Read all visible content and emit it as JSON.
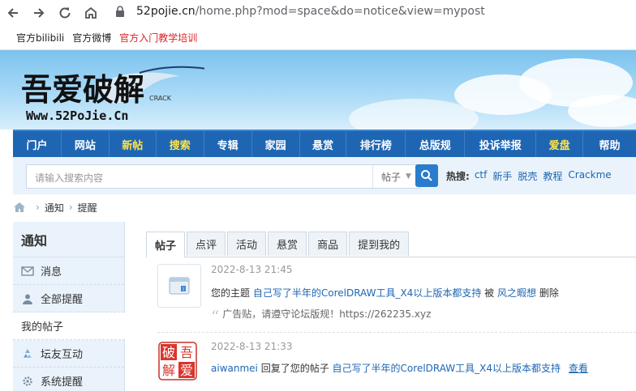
{
  "browser": {
    "url_domain": "52pojie.cn",
    "url_path": "/home.php?mod=space&do=notice&view=mypost"
  },
  "bookmarks": [
    "官方bilibili",
    "官方微博",
    "官方入门教学培训"
  ],
  "logo": {
    "wordmark": "吾爱破解",
    "site_url": "Www.52PoJie.Cn",
    "crack": "CRACK"
  },
  "nav": {
    "items": [
      {
        "label": "门户",
        "highlight": false
      },
      {
        "label": "网站",
        "highlight": false
      },
      {
        "label": "新帖",
        "highlight": true
      },
      {
        "label": "搜索",
        "highlight": true
      },
      {
        "label": "专辑",
        "highlight": false
      },
      {
        "label": "家园",
        "highlight": false
      },
      {
        "label": "悬赏",
        "highlight": false
      },
      {
        "label": "排行榜",
        "highlight": false
      },
      {
        "label": "总版规",
        "highlight": false
      },
      {
        "label": "投诉举报",
        "highlight": false
      },
      {
        "label": "爱盘",
        "highlight": true
      },
      {
        "label": "帮助",
        "highlight": false
      }
    ]
  },
  "search": {
    "placeholder": "请输入搜索内容",
    "category": "帖子",
    "hot_label": "热搜:",
    "hot_tags": [
      "ctf",
      "新手",
      "脱壳",
      "教程",
      "Crackme"
    ]
  },
  "breadcrumb": [
    "通知",
    "提醒"
  ],
  "sidebar": {
    "title": "通知",
    "items": [
      {
        "label": "消息",
        "icon": "envelope-icon",
        "active": false
      },
      {
        "label": "全部提醒",
        "icon": "person-icon",
        "active": false
      },
      {
        "label": "我的帖子",
        "icon": "none",
        "active": true
      },
      {
        "label": "坛友互动",
        "icon": "recycle-icon",
        "active": false
      },
      {
        "label": "系统提醒",
        "icon": "gear-icon",
        "active": false
      }
    ]
  },
  "tabs": [
    "帖子",
    "点评",
    "活动",
    "悬赏",
    "商品",
    "提到我的"
  ],
  "notices": [
    {
      "time": "2022-8-13 21:45",
      "prefix": "您的主题",
      "thread": "自己写了半年的CorelDRAW工具_X4以上版本都支持",
      "by": "被",
      "user": "风之暇想",
      "action": "删除",
      "quote": "广告贴，请遵守论坛版规！https://262235.xyz"
    },
    {
      "time": "2022-8-13 21:33",
      "user": "aiwanmei",
      "middle": "回复了您的帖子",
      "thread": "自己写了半年的CorelDRAW工具_X4以上版本都支持",
      "view": "查看",
      "avatar_text": [
        "破",
        "吾",
        "解",
        "爱"
      ]
    }
  ],
  "colors": {
    "nav_bg": "#1e66b3",
    "nav_highlight": "#ffe24a",
    "link": "#1e66b3",
    "bookmark_red": "#e02020"
  }
}
